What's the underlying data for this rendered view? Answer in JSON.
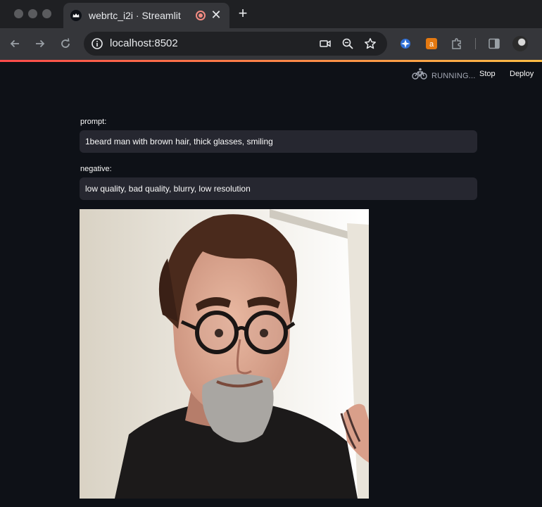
{
  "browser": {
    "tab": {
      "title": "webrtc_i2i · Streamlit",
      "close": "✕"
    },
    "new_tab": "+",
    "url": "localhost:8502"
  },
  "header": {
    "status": "RUNNING...",
    "stop": "Stop",
    "deploy": "Deploy"
  },
  "form": {
    "prompt": {
      "label": "prompt:",
      "value": "1beard man with brown hair, thick glasses, smiling"
    },
    "negative": {
      "label": "negative:",
      "value": "low quality, bad quality, blurry, low resolution"
    }
  },
  "output_image": {
    "description_icon": "generated-portrait"
  },
  "colors": {
    "background": "#0e1117",
    "input_bg": "#262730",
    "accent": "#ff4b4b"
  }
}
